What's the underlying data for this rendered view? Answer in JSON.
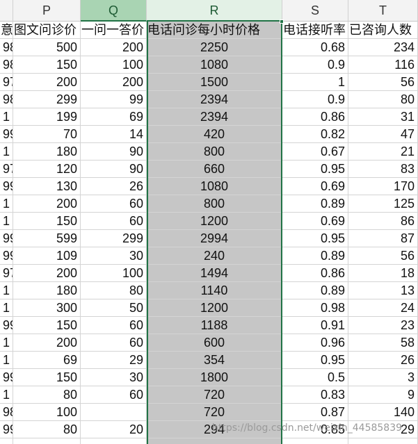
{
  "columns": [
    {
      "letter": "",
      "header": "意度"
    },
    {
      "letter": "P",
      "header": "图文问诊价"
    },
    {
      "letter": "Q",
      "header": "一问一答价"
    },
    {
      "letter": "R",
      "header": "电话问诊每小时价格"
    },
    {
      "letter": "S",
      "header": "电话接听率"
    },
    {
      "letter": "T",
      "header": "已咨询人数"
    }
  ],
  "rows": [
    [
      "98",
      "500",
      "200",
      "2250",
      "0.68",
      "234"
    ],
    [
      "98",
      "150",
      "100",
      "1080",
      "0.9",
      "116"
    ],
    [
      "97",
      "200",
      "200",
      "1500",
      "1",
      "56"
    ],
    [
      "98",
      "299",
      "99",
      "2394",
      "0.9",
      "80"
    ],
    [
      "1",
      "199",
      "69",
      "2394",
      "0.86",
      "31"
    ],
    [
      "99",
      "70",
      "14",
      "420",
      "0.82",
      "47"
    ],
    [
      "1",
      "180",
      "90",
      "800",
      "0.67",
      "21"
    ],
    [
      "97",
      "120",
      "90",
      "660",
      "0.95",
      "83"
    ],
    [
      "99",
      "130",
      "26",
      "1080",
      "0.69",
      "170"
    ],
    [
      "1",
      "200",
      "60",
      "800",
      "0.89",
      "125"
    ],
    [
      "1",
      "150",
      "60",
      "1200",
      "0.69",
      "86"
    ],
    [
      "99",
      "599",
      "299",
      "2994",
      "0.95",
      "87"
    ],
    [
      "99",
      "109",
      "30",
      "240",
      "0.89",
      "56"
    ],
    [
      "97",
      "200",
      "100",
      "1494",
      "0.86",
      "18"
    ],
    [
      "1",
      "180",
      "80",
      "1140",
      "0.89",
      "13"
    ],
    [
      "1",
      "300",
      "50",
      "1200",
      "0.98",
      "24"
    ],
    [
      "99",
      "150",
      "60",
      "1188",
      "0.91",
      "23"
    ],
    [
      "1",
      "200",
      "60",
      "600",
      "0.96",
      "58"
    ],
    [
      "1",
      "69",
      "29",
      "354",
      "0.95",
      "26"
    ],
    [
      "99",
      "150",
      "30",
      "1800",
      "0.5",
      "3"
    ],
    [
      "1",
      "80",
      "60",
      "720",
      "0.83",
      "9"
    ],
    [
      "98",
      "100",
      "",
      "720",
      "0.87",
      "140"
    ],
    [
      "99",
      "80",
      "20",
      "294",
      "0.85",
      "29"
    ],
    [
      "",
      "",
      "",
      "",
      "",
      ""
    ]
  ],
  "watermark": "https://blog.csdn.net/weixin_44585839"
}
